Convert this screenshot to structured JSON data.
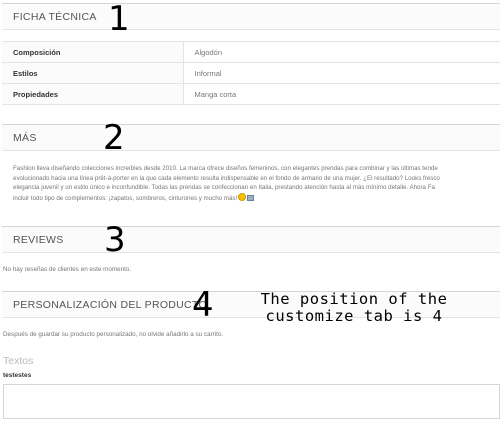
{
  "sections": {
    "ficha": {
      "title": "FICHA TÉCNICA",
      "number": "1"
    },
    "mas": {
      "title": "MÁS",
      "number": "2"
    },
    "reviews": {
      "title": "REVIEWS",
      "number": "3"
    },
    "personalizacion": {
      "title": "PERSONALIZACIÓN DEL PRODUCTO",
      "number": "4"
    }
  },
  "specs": [
    {
      "label": "Composición",
      "value": "Algodón"
    },
    {
      "label": "Estilos",
      "value": "Informal"
    },
    {
      "label": "Propiedades",
      "value": "Manga corta"
    }
  ],
  "description_lines": [
    "Fashion lleva diseñando colecciones increíbles desde 2010. La marca ofrece diseños femeninos, con elegantes prendas para combinar y las últimas tende",
    "evolucionado hacia una línea prêt-à-porter en la que cada elemento resulta indispensable en el fondo de armario de una mujer. ¿El resultado? Looks fresco",
    "elegancia juvenil y un estilo único e inconfundible. Todas las prendas se confeccionan en Italia, prestando atención hasta al más mínimo detalle. Ahora Fa",
    "incluir todo tipo de complementos: ¡zapatos, sombreros, cinturones y mucho más!"
  ],
  "reviews_empty_text": "No hay reseñas de clientes en este momento.",
  "customize": {
    "note": "Después de guardar su producto personalizado, no olvide añadirlo a su carrito.",
    "annotation_line1": "The position of the",
    "annotation_line2": "customize tab is 4",
    "textos_heading": "Textos",
    "field_label": "testestes",
    "field_value": ""
  },
  "colors": {
    "section_bg": "#fbfbfb",
    "border": "#d6d4d4",
    "muted_text": "#777777"
  }
}
